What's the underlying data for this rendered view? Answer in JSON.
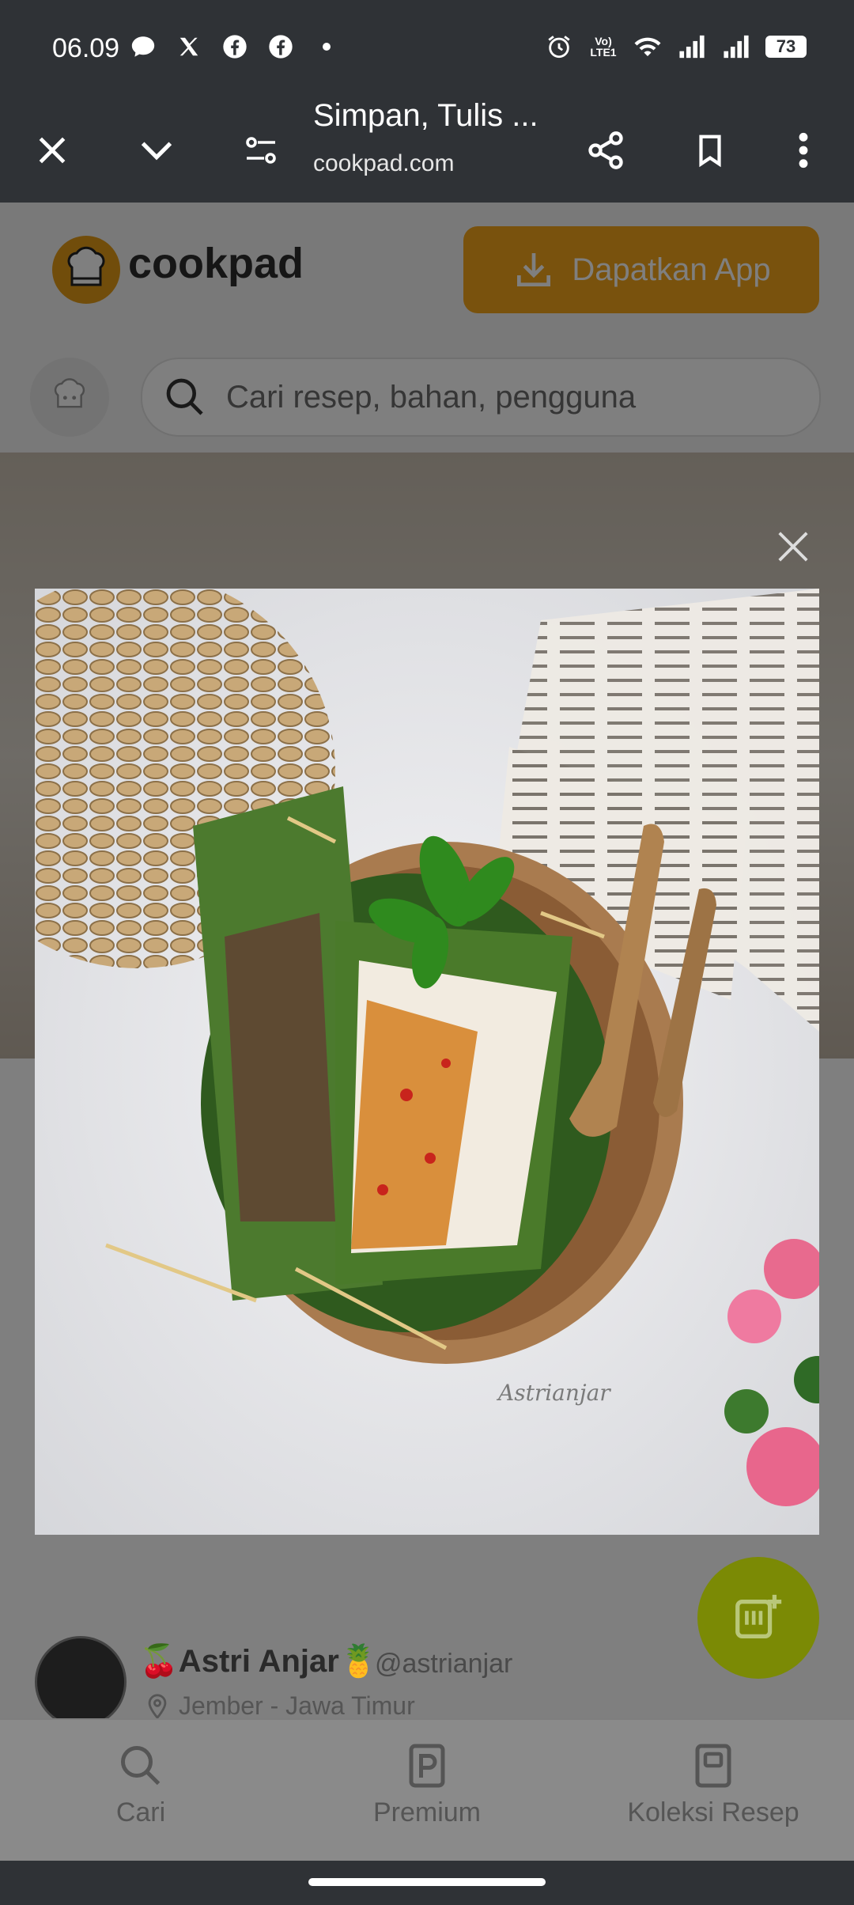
{
  "status_bar": {
    "time": "06.09",
    "left_icons": [
      "chat-bubble-icon",
      "x-logo-icon",
      "facebook-icon",
      "facebook-icon",
      "dot-icon"
    ],
    "right_icons": [
      "alarm-icon",
      "volte-icon",
      "wifi-icon",
      "signal-icon",
      "signal-icon"
    ],
    "volte_label": "Vo)\nLTE1",
    "battery": "73"
  },
  "browser_toolbar": {
    "title": "Simpan, Tulis ...",
    "url": "cookpad.com"
  },
  "header": {
    "logo_text": "cookpad",
    "get_app_label": "Dapatkan App"
  },
  "search": {
    "placeholder": "Cari resep, bahan, pengguna"
  },
  "photo": {
    "watermark": "Astrianjar"
  },
  "author": {
    "name": "🍒Astri Anjar🍍",
    "handle": "@astrianjar",
    "location": "Jember - Jawa Timur"
  },
  "bottom_nav": [
    {
      "label": "Cari",
      "icon": "search-icon"
    },
    {
      "label": "Premium",
      "icon": "premium-icon"
    },
    {
      "label": "Koleksi Resep",
      "icon": "recipe-collection-icon"
    }
  ],
  "colors": {
    "accent": "#f2a51a",
    "fab": "#7b8a05",
    "status_bar": "#2f3236"
  }
}
